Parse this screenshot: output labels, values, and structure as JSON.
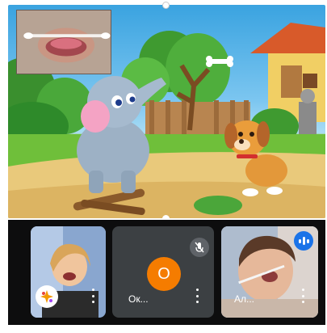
{
  "stage": {
    "pip_icon": "self-view-mouth-closeup"
  },
  "participants": [
    {
      "name": "",
      "video": true,
      "effects_icon": "sparkle-icon",
      "menu_icon": "more-vert-icon"
    },
    {
      "name": "Ок...",
      "video": false,
      "avatar_letter": "О",
      "avatar_color": "#f57c00",
      "muted": true,
      "menu_icon": "more-vert-icon"
    },
    {
      "name": "Ал...",
      "video": true,
      "speaking": true,
      "menu_icon": "more-vert-icon"
    }
  ],
  "colors": {
    "tray_bg": "#0d0d0e",
    "tile_gray": "#3c4043",
    "avatar": "#f57c00",
    "speaking": "#1a73e8"
  }
}
